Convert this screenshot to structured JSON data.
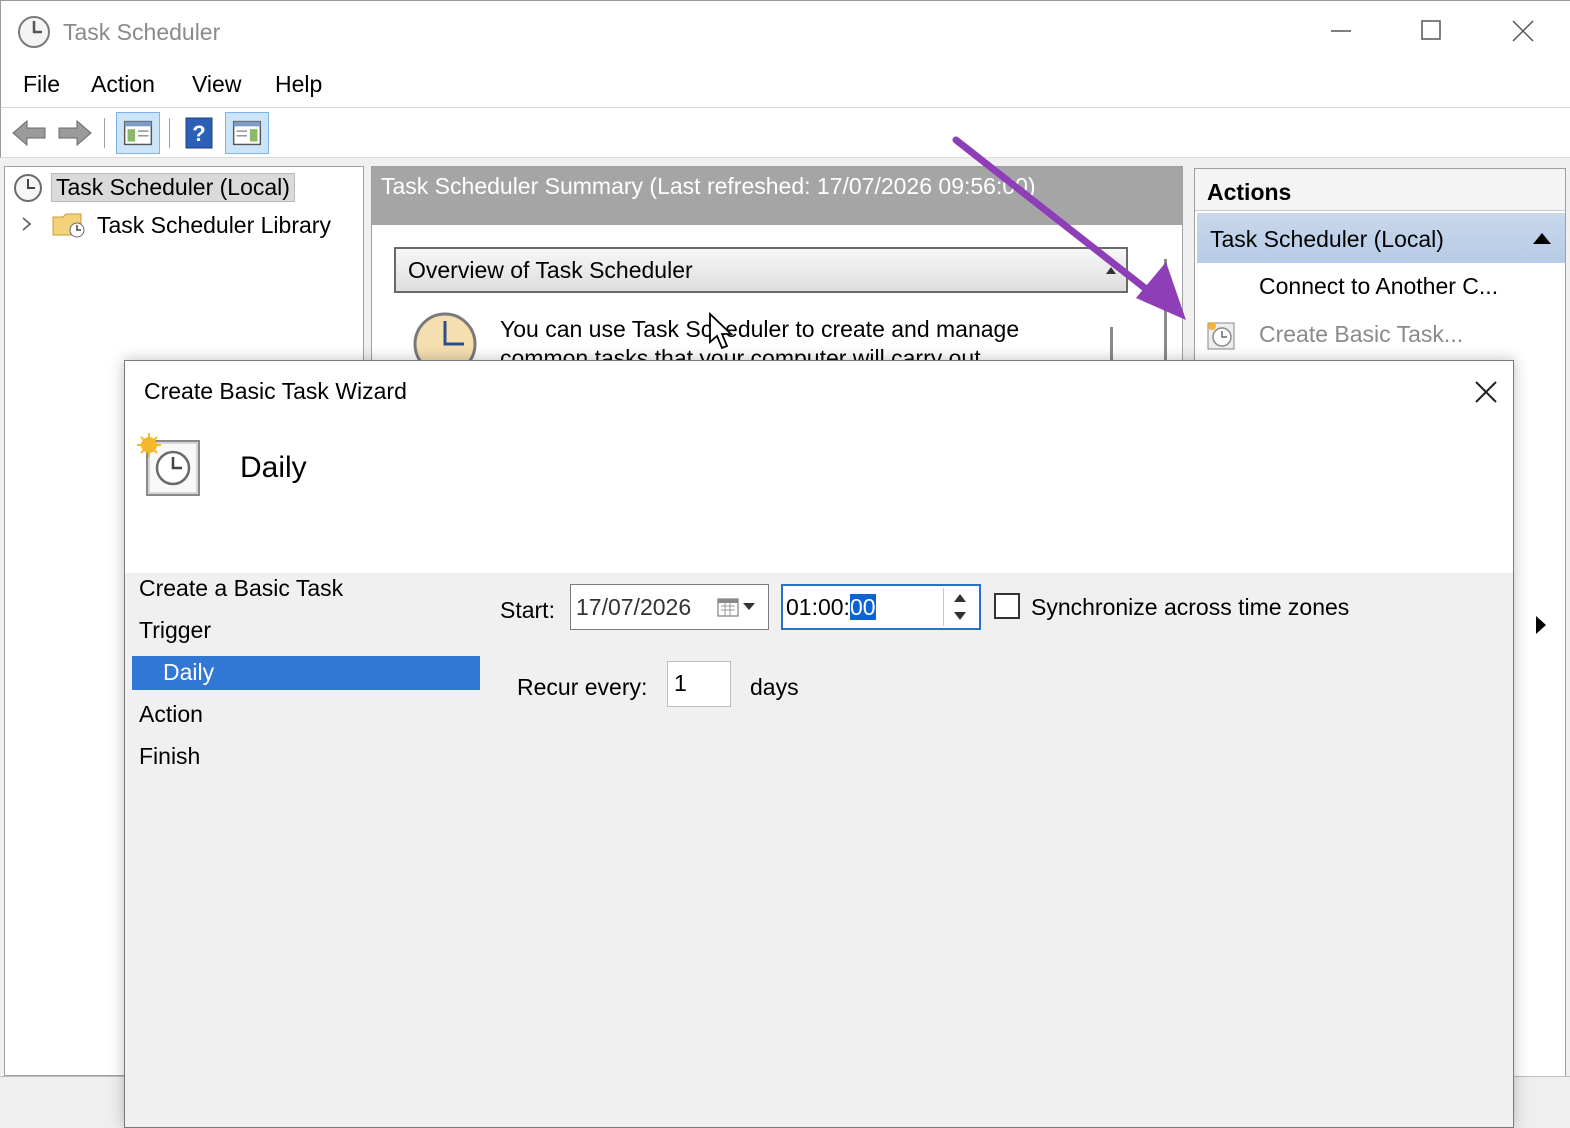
{
  "window": {
    "title": "Task Scheduler"
  },
  "menu": [
    "File",
    "Action",
    "View",
    "Help"
  ],
  "toolbar": {
    "buttons": [
      "back-arrow-icon",
      "forward-arrow-icon",
      "show-hide-console-tree-icon",
      "help-icon",
      "show-hide-action-pane-icon"
    ]
  },
  "tree": {
    "root_label": "Task Scheduler (Local)",
    "library_label": "Task Scheduler Library"
  },
  "center": {
    "header_title": "Task Scheduler Summary (Last refreshed: 17/07/2026 09:56:00)",
    "overview_title": "Overview of Task Scheduler",
    "overview_text": "You can use Task Scheduler to create and manage common tasks that your computer will carry out"
  },
  "actions": {
    "title": "Actions",
    "group_title": "Task Scheduler (Local)",
    "items": [
      "Connect to Another C...",
      "Create Basic Task..."
    ]
  },
  "wizard": {
    "title": "Create Basic Task Wizard",
    "header_title": "Daily",
    "steps": [
      "Create a Basic Task",
      "Trigger",
      "Daily",
      "Action",
      "Finish"
    ],
    "active_step": "Daily",
    "start_label": "Start:",
    "start_date": "17/07/2026",
    "start_time_prefix": "01:00:",
    "start_time_selected": "00",
    "sync_label": "Synchronize across time zones",
    "sync_checked": false,
    "recur_label": "Recur every:",
    "recur_value": "1",
    "recur_unit": "days"
  },
  "colors": {
    "selection_blue": "#3178d6",
    "annotation_arrow": "#8e3fb8",
    "actions_group_bg": "#c8d8ec"
  }
}
